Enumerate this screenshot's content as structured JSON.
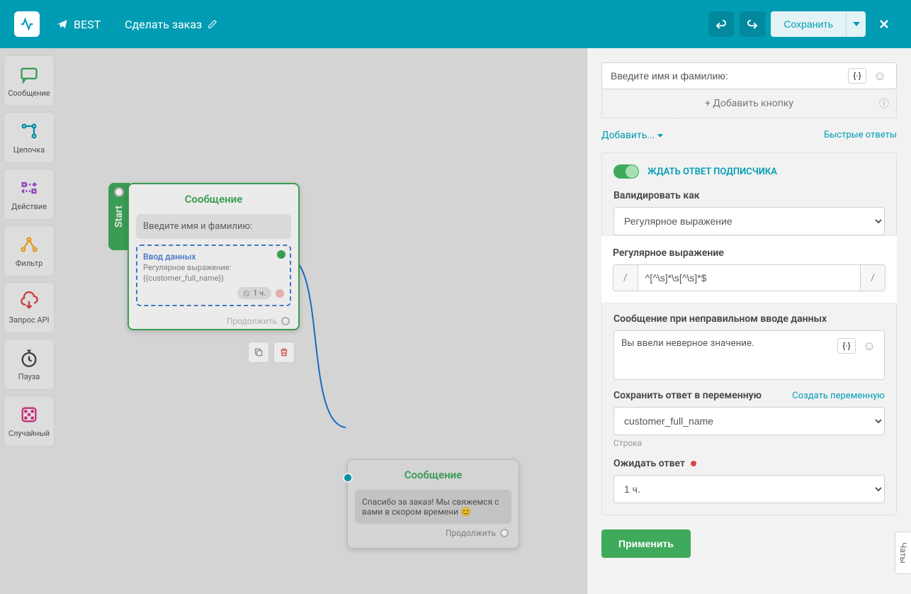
{
  "header": {
    "bot_name": "BEST",
    "flow_name": "Сделать заказ",
    "undo_tooltip": "Undo",
    "redo_tooltip": "Redo",
    "save_label": "Сохранить"
  },
  "toolbar": {
    "message": "Сообщение",
    "chain": "Цепочка",
    "action": "Действие",
    "filter": "Фильтр",
    "api": "Запрос API",
    "pause": "Пауза",
    "random": "Случайный"
  },
  "node1": {
    "start_label": "Start",
    "title": "Сообщение",
    "message_text": "Введите имя и фамилию:",
    "input_title": "Ввод данных",
    "input_desc1": "Регулярное выражение:",
    "input_desc2": "{{customer_full_name}}",
    "timer_value": "1 ч.",
    "continue_label": "Продолжить"
  },
  "node2": {
    "title": "Сообщение",
    "message_text": "Спасибо за заказ! Мы свяжемся с вами в скором времени 😊",
    "continue_label": "Продолжить"
  },
  "panel": {
    "prompt_text": "Введите имя и фамилию:",
    "add_button_label": "+ Добавить кнопку",
    "add_link": "Добавить...",
    "quick_replies": "Быстрые ответы",
    "wait_response": "ЖДАТЬ ОТВЕТ ПОДПИСЧИКА",
    "validate_label": "Валидировать как",
    "validate_value": "Регулярное выражение",
    "regex_label": "Регулярное выражение",
    "regex_value": "^[^\\s]*\\s[^\\s]*$",
    "error_label": "Сообщение при неправильном вводе данных",
    "error_value": "Вы ввели неверное значение.",
    "save_var_label": "Сохранить ответ в переменную",
    "create_var_link": "Создать переменную",
    "var_value": "customer_full_name",
    "var_type": "Строка",
    "wait_label": "Ожидать ответ",
    "wait_value": "1 ч.",
    "apply_label": "Применить",
    "variable_placeholder": "{·}"
  },
  "chat_tab": "Чаты"
}
